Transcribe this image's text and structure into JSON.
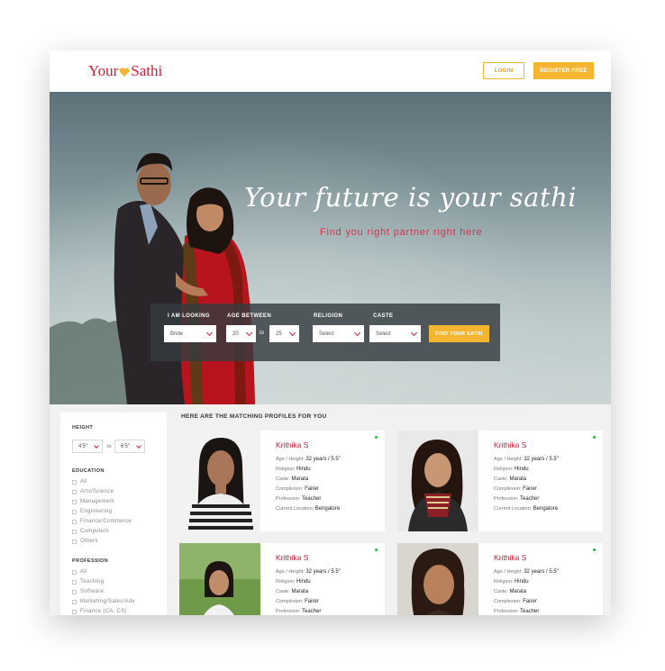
{
  "header": {
    "logo_left": "Your",
    "logo_right": "Sathi",
    "login_label": "LOGIN",
    "register_label": "REGISTER FREE"
  },
  "hero": {
    "tagline": "Your future is your sathi",
    "subtagline": "Find you right partner right here"
  },
  "search": {
    "looking_label": "I AM LOOKING",
    "looking_value": "Bride",
    "age_label": "AGE BETWEEN",
    "age_from": "20",
    "age_to_sep": "to",
    "age_to": "25",
    "religion_label": "RELIGION",
    "religion_value": "Select",
    "caste_label": "CASTE",
    "caste_value": "Select",
    "find_label": "FIND YOUR SATHI"
  },
  "sidebar": {
    "height_label": "HEIGHT",
    "height_from": "4'5\"",
    "height_sep": "to",
    "height_to": "6'5\"",
    "education_label": "EDUCATION",
    "education": [
      "All",
      "Arts/Science",
      "Management",
      "Engineering",
      "Finance/Commerce",
      "Computers",
      "Others"
    ],
    "profession_label": "PROFESSION",
    "profession": [
      "All",
      "Teaching",
      "Software",
      "Marketing/Sales/Adv",
      "Finance (CA, CS)"
    ]
  },
  "results": {
    "title": "HERE ARE THE MATCHING PROFILES FOR YOU",
    "field_labels": {
      "age": "Age / Height:",
      "religion": "Religion:",
      "caste": "Caste:",
      "complexion": "Complexion:",
      "profession": "Profession:",
      "location": "Current Location:"
    },
    "profiles": [
      {
        "name": "Krithika S",
        "age": "32 years / 5.5\"",
        "religion": "Hindu",
        "caste": "Marata",
        "complexion": "Fairer",
        "profession": "Teacher",
        "location": "Bengalore"
      },
      {
        "name": "Krithika S",
        "age": "32 years / 5.5\"",
        "religion": "Hindu",
        "caste": "Marata",
        "complexion": "Fairer",
        "profession": "Teacher",
        "location": "Bengalore"
      },
      {
        "name": "Krithika S",
        "age": "32 years / 5.5\"",
        "religion": "Hindu",
        "caste": "Marata",
        "complexion": "Fairer",
        "profession": "Teacher",
        "location": ""
      },
      {
        "name": "Krithika S",
        "age": "32 years / 5.5\"",
        "religion": "Hindu",
        "caste": "Marata",
        "complexion": "Fairer",
        "profession": "Teacher",
        "location": ""
      }
    ]
  },
  "colors": {
    "brand_red": "#c4223b",
    "brand_yellow": "#f4b630",
    "online_green": "#2db34a"
  }
}
